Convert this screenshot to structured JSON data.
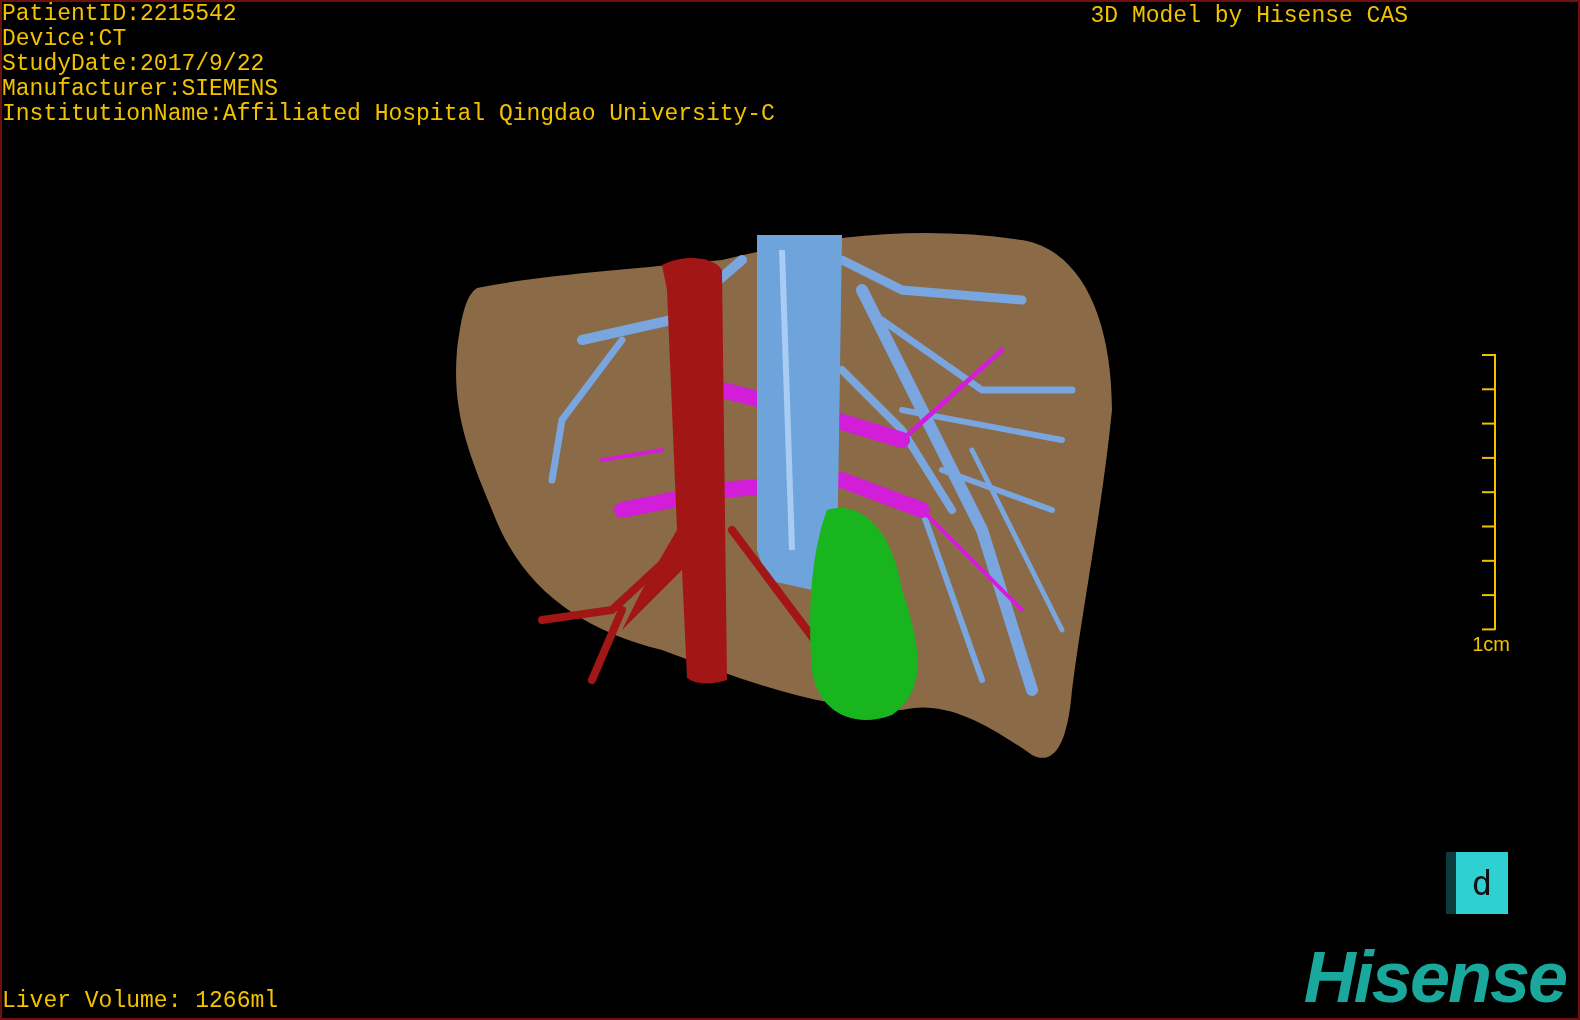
{
  "header": {
    "info_lines": [
      "PatientID:2215542",
      "Device:CT",
      "StudyDate:2017/9/22",
      "Manufacturer:SIEMENS",
      "InstitutionName:Affiliated Hospital Qingdao University-C"
    ],
    "caption": "3D Model by Hisense CAS"
  },
  "scale": {
    "label": "1cm"
  },
  "footer": {
    "volume": "Liver Volume: 1266ml",
    "key": "d",
    "logo": "Hisense"
  }
}
